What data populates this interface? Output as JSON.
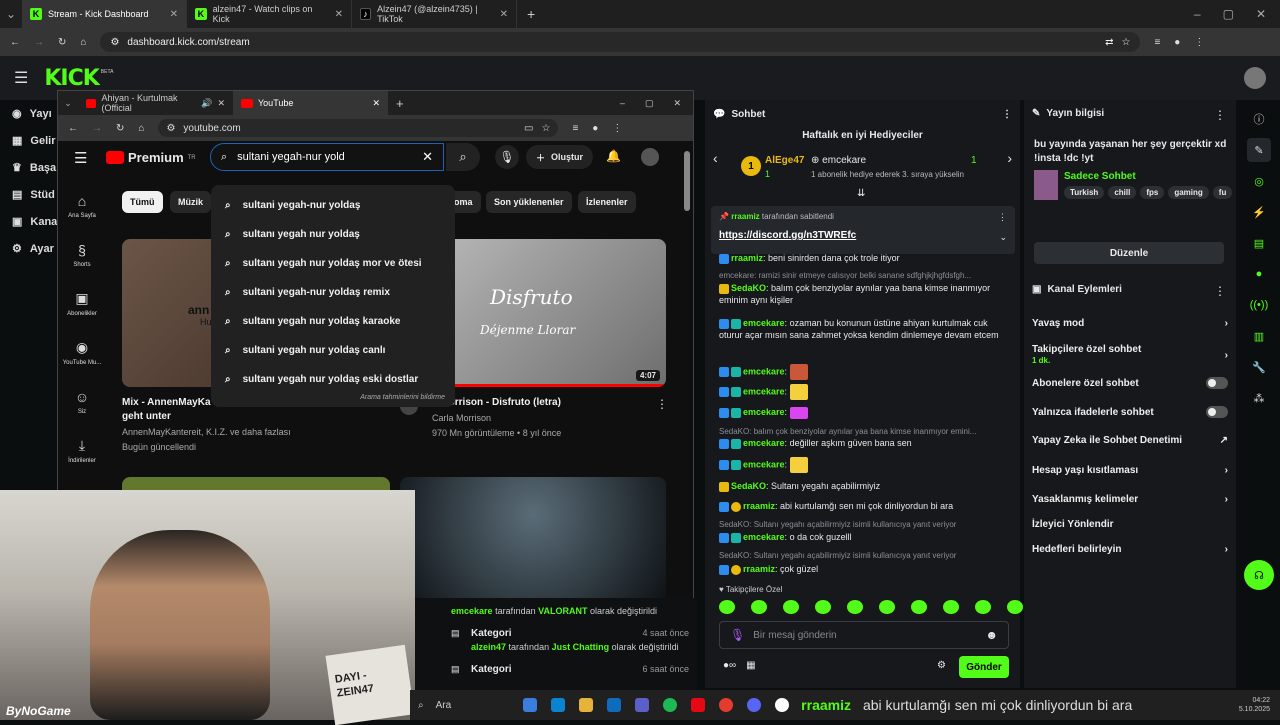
{
  "browser": {
    "tabs": [
      {
        "label": "Stream - Kick Dashboard",
        "icon": "kick-icon"
      },
      {
        "label": "alzein47 - Watch clips on Kick",
        "icon": "kick-icon"
      },
      {
        "label": "Alzein47 (@alzein4735) | TikTok",
        "icon": "tiktok-icon"
      }
    ],
    "url": "dashboard.kick.com/stream"
  },
  "kick": {
    "logo": "KICK",
    "beta": "BETA",
    "nav": [
      "Yayı",
      "Gelir",
      "Başa",
      "Stüd",
      "Kana",
      "Ayar"
    ]
  },
  "yt": {
    "tabs": [
      "Ahiyan - Kurtulmak (Official",
      "YouTube"
    ],
    "url": "youtube.com",
    "logo": "Premium",
    "logo_sup": "TR",
    "search_value": "sultani yegah-nur yold",
    "create_label": "Oluştur",
    "sidebar": [
      "Ana Sayfa",
      "Shorts",
      "Abonelikler",
      "YouTube Mu...",
      "Siz",
      "İndirilenler"
    ],
    "suggestions": [
      "sultani yegah-nur yoldaş",
      "sultanı yegah nur yoldaş",
      "sultanı yegah nur yoldaş mor ve ötesi",
      "sultani yegah-nur yoldaş remix",
      "sultanı yegah nur yoldaş karaoke",
      "sultani yegah nur yoldaş canlı",
      "sultanı yegah nur yoldaş eski dostlar"
    ],
    "suggest_footer": "Arama tahminlerini bildirme",
    "chips": [
      "Tümü",
      "Müzik",
      "oma",
      "Son yüklenenler",
      "İzlenenler"
    ],
    "video1": {
      "title": "Mix - AnnenMayKa",
      "title2": "geht unter",
      "meta1": "AnnenMayKantereit, K.I.Z. ve daha fazlası",
      "meta2": "Bugün güncellendi",
      "thumb_text": "ann",
      "thumb_text2": "Hu"
    },
    "video2": {
      "title": "a Morrison - Disfruto (letra)",
      "channel": "Carla Morrison",
      "meta": "970 Mn görüntüleme • 8 yıl önce",
      "duration": "4:07",
      "thumb_title": "Disfruto",
      "thumb_sub": "Déjenme Llorar"
    }
  },
  "recent": [
    {
      "user": "emcekare",
      "text": "tarafından",
      "cat": "VALORANT",
      "text2": "olarak değiştirildi",
      "time": ""
    },
    {
      "title": "Kategori",
      "time": "4 saat önce",
      "user": "alzein47",
      "text": "tarafından",
      "cat": "Just Chatting",
      "text2": "olarak değiştirildi"
    },
    {
      "title": "Kategori",
      "time": "6 saat önce",
      "user": "",
      "text": "",
      "cat": "",
      "text2": ""
    }
  ],
  "chat": {
    "title": "Sohbet",
    "gifters_title": "Haftalık en iyi Hediyeciler",
    "gifter1": "AlEge47",
    "gifter1_count": "1",
    "gifter2": "emcekare",
    "gifter2_count": "1",
    "gifter_note": "1 abonelik hediye ederek 3. sıraya yükselin",
    "pinned_by": "rraamiz",
    "pinned_text": "tarafından sabitlendi",
    "pinned_link": "https://discord.gg/n3TWREfc",
    "messages": [
      {
        "user": "rraamiz",
        "text": "beni sinirden dana çok trole itiyor",
        "sys": false
      },
      {
        "user": "",
        "text": "emcekare: ramizi sinir etmeye calısıyor belki sanane sdfghjkjhgfdsfgh...",
        "sys": true
      },
      {
        "user": "SedaKO",
        "text": "balım çok benziyolar aynılar yaa bana kimse inanmıyor eminim aynı kişiler",
        "sys": false
      },
      {
        "user": "emcekare",
        "text": "ozaman bu konunun üstüne ahiyan kurtulmak cuk oturur açar mısın sana zahmet yoksa kendim dinlemeye devam etcem",
        "sys": false
      },
      {
        "user": "emcekare",
        "text": "",
        "sys": false
      },
      {
        "user": "emcekare",
        "text": "",
        "sys": false
      },
      {
        "user": "emcekare",
        "text": "",
        "sys": false
      },
      {
        "user": "",
        "text": "SedaKO: balım çok benziyolar aynılar yaa bana kimse inanmıyor emini...",
        "sys": true
      },
      {
        "user": "emcekare",
        "text": "değiller aşkım güven bana sen",
        "sys": false
      },
      {
        "user": "emcekare",
        "text": "",
        "sys": false
      },
      {
        "user": "SedaKO",
        "text": "Sultanı yegahı açabilirmiyiz",
        "sys": false
      },
      {
        "user": "rraamiz",
        "text": "abi kurtulamğı sen mi çok dinliyordun bi ara",
        "sys": false
      },
      {
        "user": "",
        "text": "SedaKO: Sultanı yegahı açabilirmiyiz isimli kullanıcıya yanıt veriyor",
        "sys": true
      },
      {
        "user": "emcekare",
        "text": "o da cok guzelll",
        "sys": false
      },
      {
        "user": "",
        "text": "SedaKO: Sultanı yegahı açabilirmiyiz isimli kullanıcıya yanıt veriyor",
        "sys": true
      },
      {
        "user": "rraamiz",
        "text": "çok güzel",
        "sys": false
      }
    ],
    "followers_label": "Takipçilere Özel",
    "input_placeholder": "Bir mesaj gönderin",
    "send_label": "Gönder"
  },
  "right": {
    "stream_info_title": "Yayın bilgisi",
    "stream_title": "bu yayında yaşanan her şey gerçektir xd !insta !dc !yt",
    "category": "Sadece Sohbet",
    "tags": [
      "Turkish",
      "chill",
      "fps",
      "gaming",
      "fu"
    ],
    "edit_label": "Düzenle",
    "actions_title": "Kanal Eylemleri",
    "actions": [
      {
        "label": "Yavaş mod",
        "control": "chevron"
      },
      {
        "label": "Takipçilere özel sohbet",
        "sub": "1 dk.",
        "control": "chevron"
      },
      {
        "label": "Abonelere özel sohbet",
        "control": "toggle"
      },
      {
        "label": "Yalnızca ifadelerle sohbet",
        "control": "toggle"
      },
      {
        "label": "Yapay Zeka ile Sohbet Denetimi",
        "control": "external"
      },
      {
        "label": "Hesap yaşı kısıtlaması",
        "control": "chevron"
      },
      {
        "label": "Yasaklanmış kelimeler",
        "control": "chevron"
      },
      {
        "label": "İzleyici Yönlendir",
        "control": "none"
      },
      {
        "label": "Hedefleri belirleyin",
        "control": "chevron"
      }
    ]
  },
  "taskbar": {
    "search": "Ara",
    "ticker": "abi kurtulamğı sen mi çok dinliyordun bi ara",
    "ticker_user": "rraamiz",
    "time": "04:22",
    "date": "5.10.2025"
  },
  "overlay": {
    "brand": "ByNoGame",
    "shirt": "DAYI -ZEIN47"
  }
}
